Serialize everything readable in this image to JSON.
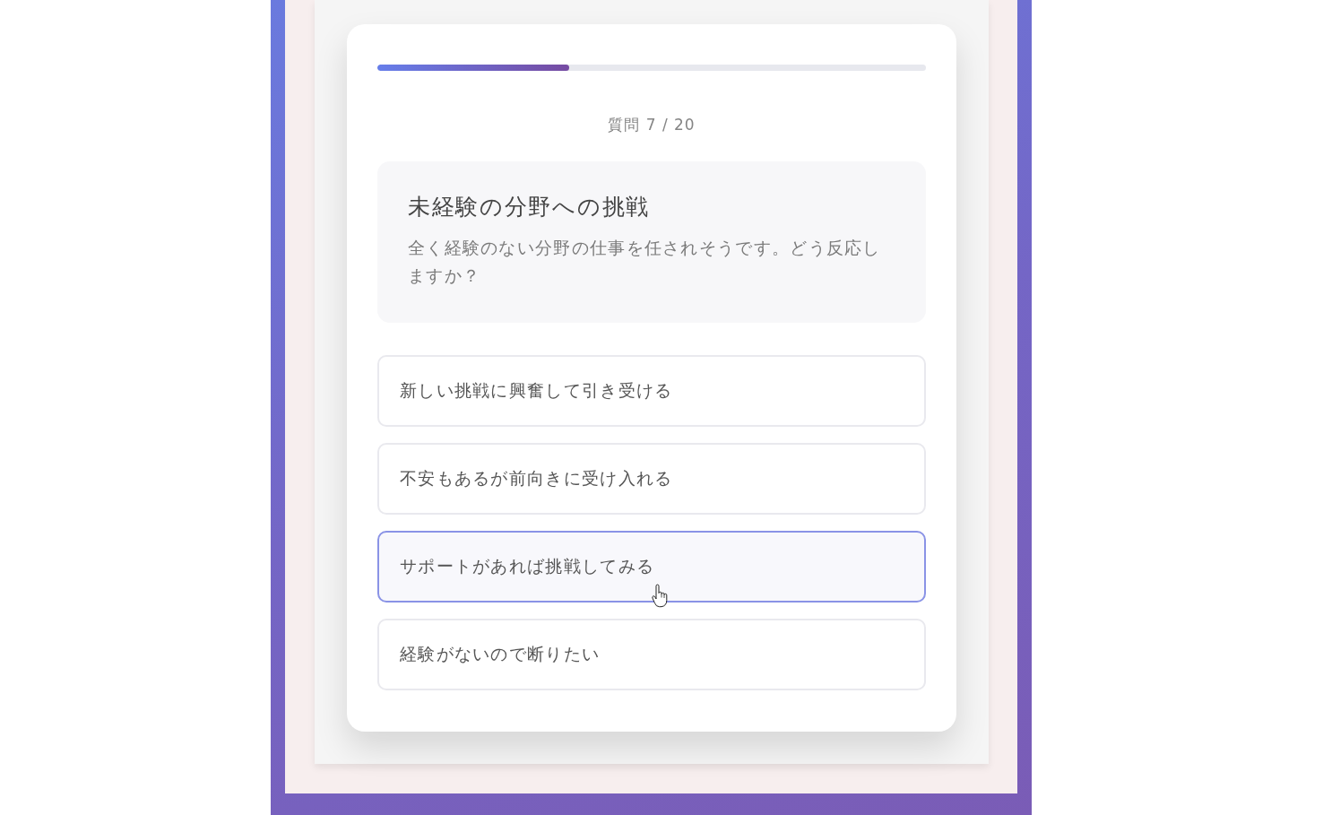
{
  "progress": {
    "level": 0.35
  },
  "counter": "質問 7 / 20",
  "question": {
    "title": "未経験の分野への挑戦",
    "text": "全く経験のない分野の仕事を任されそうです。どう反応しますか？"
  },
  "options": [
    {
      "label": "新しい挑戦に興奮して引き受ける",
      "hovered": false
    },
    {
      "label": "不安もあるが前向きに受け入れる",
      "hovered": false
    },
    {
      "label": "サポートがあれば挑戦してみる",
      "hovered": true
    },
    {
      "label": "経験がないので断りたい",
      "hovered": false
    }
  ]
}
